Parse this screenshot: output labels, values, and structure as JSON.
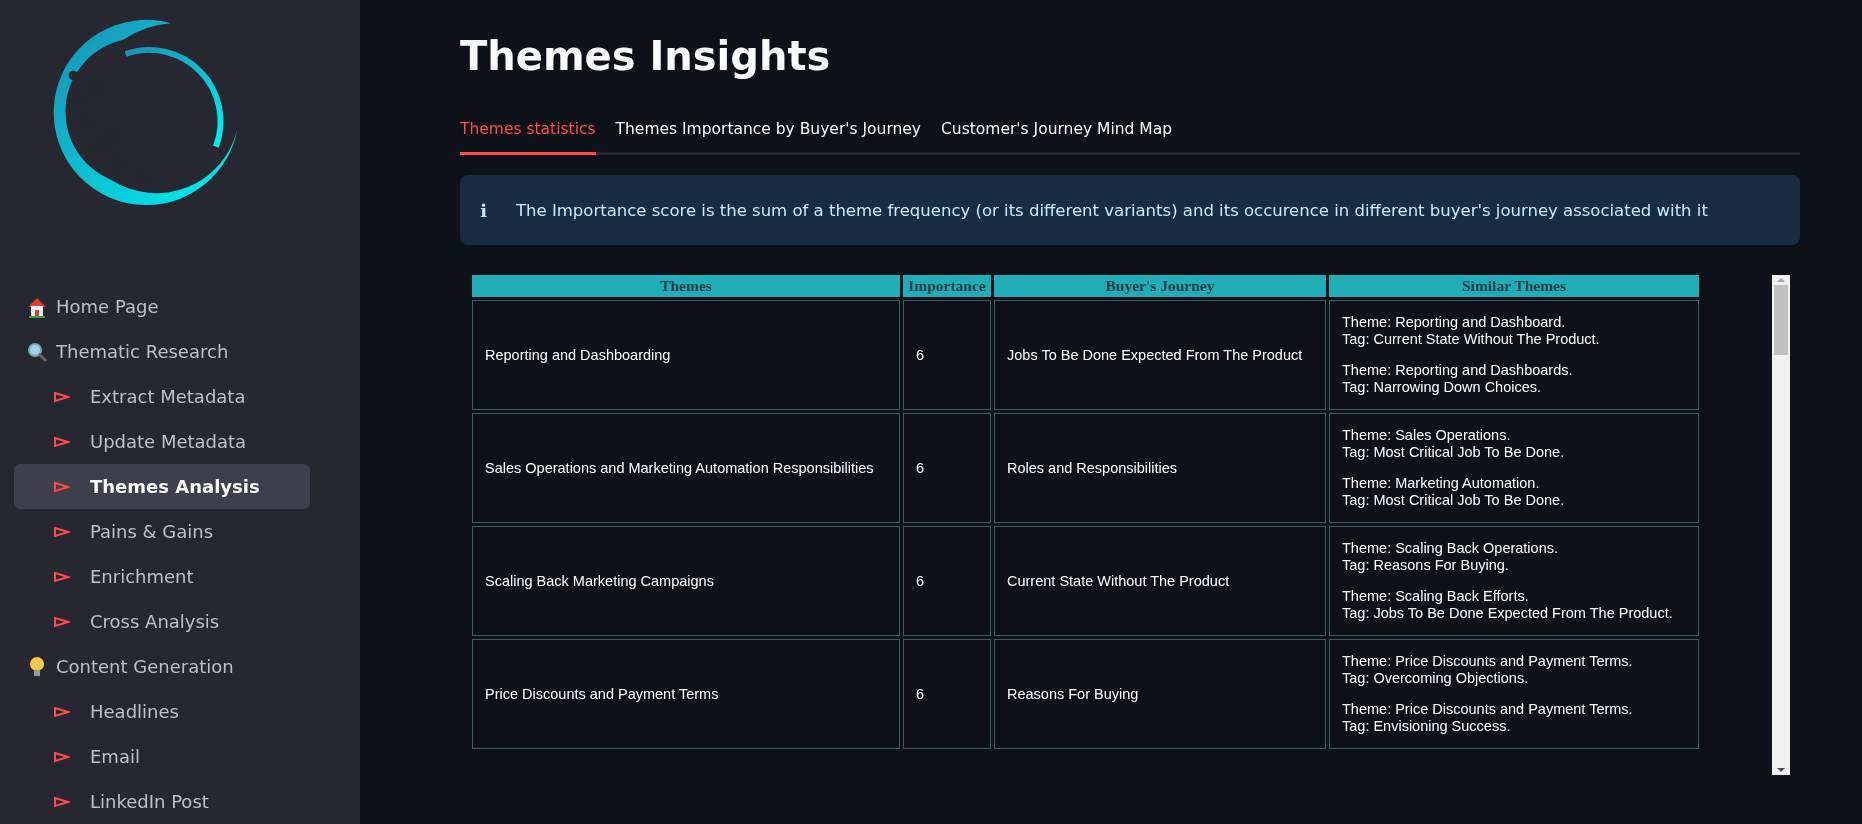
{
  "sidebar": {
    "items": [
      {
        "label": "Home Page",
        "kind": "house",
        "selected": false
      },
      {
        "label": "Thematic Research",
        "kind": "search",
        "selected": false,
        "children": [
          {
            "label": "Extract Metadata",
            "selected": false
          },
          {
            "label": "Update Metadata",
            "selected": false
          },
          {
            "label": "Themes Analysis",
            "selected": true
          },
          {
            "label": "Pains & Gains",
            "selected": false
          },
          {
            "label": "Enrichment",
            "selected": false
          },
          {
            "label": "Cross Analysis",
            "selected": false
          }
        ]
      },
      {
        "label": "Content Generation",
        "kind": "bulb",
        "selected": false,
        "children": [
          {
            "label": "Headlines",
            "selected": false
          },
          {
            "label": "Email",
            "selected": false
          },
          {
            "label": "LinkedIn Post",
            "selected": false
          }
        ]
      }
    ]
  },
  "page": {
    "title": "Themes Insights",
    "tabs": [
      {
        "label": "Themes statistics",
        "selected": true
      },
      {
        "label": "Themes Importance by Buyer's Journey",
        "selected": false
      },
      {
        "label": "Customer's Journey Mind Map",
        "selected": false
      }
    ],
    "info": {
      "icon": "ℹ",
      "text": "The Importance score is the sum of a theme frequency (or its different variants) and its occurence in different buyer's journey associated with it"
    },
    "table": {
      "columns": [
        "Themes",
        "Importance",
        "Buyer's Journey",
        "Similar Themes"
      ],
      "rows": [
        {
          "theme": "Reporting and Dashboarding",
          "importance": "6",
          "journey": "Jobs To Be Done Expected From The Product",
          "similar": [
            {
              "theme": "Theme: Reporting and Dashboard.",
              "tag": "Tag: Current State Without The Product."
            },
            {
              "theme": "Theme: Reporting and Dashboards.",
              "tag": "Tag: Narrowing Down Choices."
            }
          ]
        },
        {
          "theme": "Sales Operations and Marketing Automation Responsibilities",
          "importance": "6",
          "journey": "Roles and Responsibilities",
          "similar": [
            {
              "theme": "Theme: Sales Operations.",
              "tag": "Tag: Most Critical Job To Be Done."
            },
            {
              "theme": "Theme: Marketing Automation.",
              "tag": "Tag: Most Critical Job To Be Done."
            }
          ]
        },
        {
          "theme": "Scaling Back Marketing Campaigns",
          "importance": "6",
          "journey": "Current State Without The Product",
          "similar": [
            {
              "theme": "Theme: Scaling Back Operations.",
              "tag": "Tag: Reasons For Buying."
            },
            {
              "theme": "Theme: Scaling Back Efforts.",
              "tag": "Tag: Jobs To Be Done Expected From The Product."
            }
          ]
        },
        {
          "theme": "Price Discounts and Payment Terms",
          "importance": "6",
          "journey": "Reasons For Buying",
          "similar": [
            {
              "theme": "Theme: Price Discounts and Payment Terms.",
              "tag": "Tag: Overcoming Objections."
            },
            {
              "theme": "Theme: Price Discounts and Payment Terms.",
              "tag": "Tag: Envisioning Success."
            }
          ]
        }
      ]
    }
  }
}
